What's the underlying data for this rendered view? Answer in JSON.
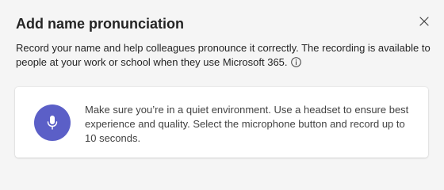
{
  "dialog": {
    "title": "Add name pronunciation",
    "close_icon": "close-icon",
    "description": "Record your name and help colleagues pronounce it correctly. The recording is available to people at your work or school when they use Microsoft 365.",
    "info_icon": "info-icon"
  },
  "card": {
    "mic_icon": "microphone-icon",
    "instructions": "Make sure you’re in a quiet environment. Use a headset to ensure best experience and quality. Select the microphone button and record up to 10 seconds."
  },
  "colors": {
    "accent": "#5b5fc7",
    "background": "#f5f5f5",
    "card": "#ffffff",
    "text": "#242424"
  }
}
